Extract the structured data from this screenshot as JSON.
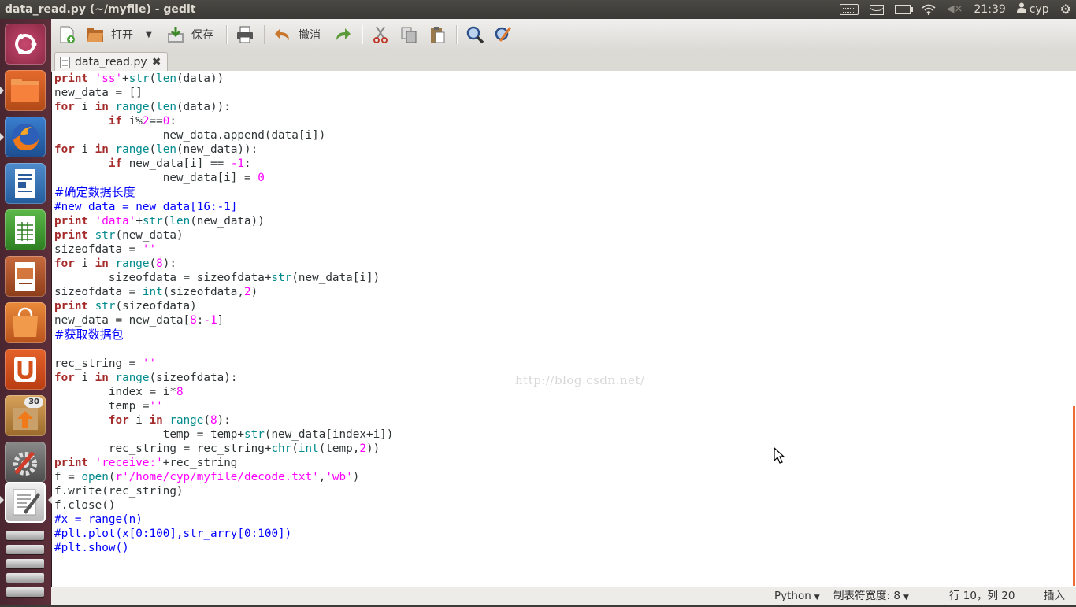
{
  "window": {
    "title": "data_read.py (~/myfile) - gedit"
  },
  "panel": {
    "time": "21:39",
    "user": "cyp"
  },
  "launcher": {
    "items": [
      {
        "name": "ubuntu-dash"
      },
      {
        "name": "files"
      },
      {
        "name": "firefox"
      },
      {
        "name": "libreoffice-writer"
      },
      {
        "name": "libreoffice-calc"
      },
      {
        "name": "libreoffice-impress"
      },
      {
        "name": "software-center"
      },
      {
        "name": "ubuntu-one"
      },
      {
        "name": "update-manager",
        "badge": "30"
      },
      {
        "name": "system-settings"
      },
      {
        "name": "gedit"
      }
    ]
  },
  "toolbar": {
    "open_label": "打开",
    "save_label": "保存",
    "undo_label": "撤消"
  },
  "tab": {
    "filename": "data_read.py",
    "close": "✖"
  },
  "editor": {
    "code_lines": [
      "print 'ss'+str(len(data))",
      "new_data = []",
      "for i in range(len(data)):",
      "        if i%2==0:",
      "                new_data.append(data[i])",
      "for i in range(len(new_data)):",
      "        if new_data[i] == -1:",
      "                new_data[i] = 0",
      "#确定数据长度",
      "#new_data = new_data[16:-1]",
      "print 'data'+str(len(new_data))",
      "print str(new_data)",
      "sizeofdata = ''",
      "for i in range(8):",
      "        sizeofdata = sizeofdata+str(new_data[i])",
      "sizeofdata = int(sizeofdata,2)",
      "print str(sizeofdata)",
      "new_data = new_data[8:-1]",
      "#获取数据包",
      "",
      "rec_string = ''",
      "for i in range(sizeofdata):",
      "        index = i*8",
      "        temp =''",
      "        for i in range(8):",
      "                temp = temp+str(new_data[index+i])",
      "        rec_string = rec_string+chr(int(temp,2))",
      "print 'receive:'+rec_string",
      "f = open(r'/home/cyp/myfile/decode.txt','wb')",
      "f.write(rec_string)",
      "f.close()",
      "#x = range(n)",
      "#plt.plot(x[0:100],str_arry[0:100])",
      "#plt.show()"
    ],
    "watermark": "http://blog.csdn.net/"
  },
  "statusbar": {
    "language": "Python",
    "tab_width": "制表符宽度: 8",
    "position": "行 10，列 20",
    "mode": "插入"
  },
  "colors": {
    "keyword": "#a52a2a",
    "builtin": "#008a8c",
    "string": "#ff00ff",
    "comment": "#0000ff",
    "launcher_bg": "#5c2f3a",
    "scroll_thumb": "#ef6b3a"
  }
}
